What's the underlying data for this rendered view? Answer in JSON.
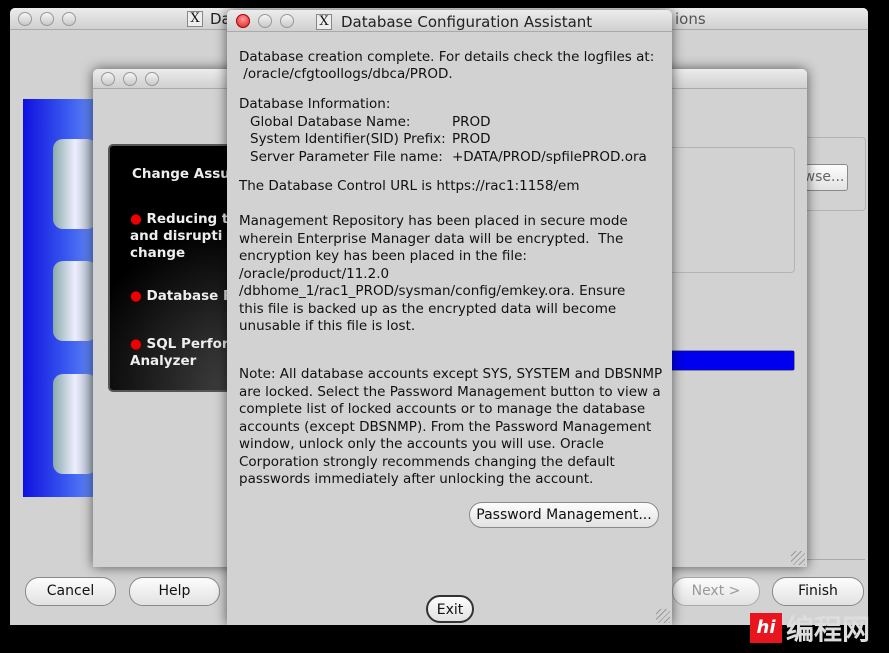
{
  "back_window": {
    "title_left": "Da",
    "title_right": "ions",
    "browse_label": "wse...",
    "buttons": {
      "cancel": "Cancel",
      "help": "Help",
      "next": "Next",
      "finish": "Finish"
    }
  },
  "middle_window": {
    "slide": {
      "heading": "Change Assur",
      "bullets": [
        "Reducing th\nand disrupti\nchange",
        "Database Re",
        "SQL Perforn\nAnalyzer"
      ]
    },
    "progress_percent": 100,
    "progress_color": "#0000ee"
  },
  "dialog": {
    "title": "Database Configuration Assistant",
    "lines": {
      "l1": "Database creation complete. For details check the logfiles at:",
      "l2": " /oracle/cfgtoollogs/dbca/PROD.",
      "info_heading": "Database Information:",
      "info": [
        {
          "label": "Global Database Name:",
          "value": "PROD"
        },
        {
          "label": "System Identifier(SID) Prefix:",
          "value": "PROD"
        },
        {
          "label": "Server Parameter File name:",
          "value": "+DATA/PROD/spfilePROD.ora"
        }
      ],
      "url": "The Database Control URL is https://rac1:1158/em",
      "repo": "Management Repository has been placed in secure mode\nwherein Enterprise Manager data will be encrypted.  The\nencryption key has been placed in the file:\n/oracle/product/11.2.0\n/dbhome_1/rac1_PROD/sysman/config/emkey.ora. Ensure\nthis file is backed up as the encrypted data will become\nunusable if this file is lost.",
      "note": "Note: All database accounts except SYS, SYSTEM and DBSNMP\nare locked. Select the Password Management button to view a\ncomplete list of locked accounts or to manage the database\naccounts (except DBSNMP). From the Password Management\nwindow, unlock only the accounts you will use. Oracle\nCorporation strongly recommends changing the default\npasswords immediately after unlocking the account."
    },
    "password_button": "Password Management...",
    "exit_button": "Exit"
  },
  "watermark": "编程网"
}
